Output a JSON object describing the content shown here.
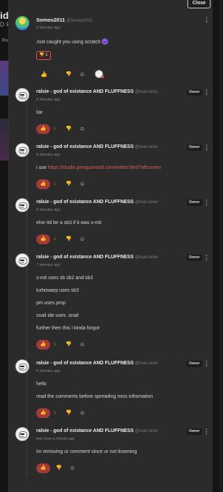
{
  "backdrop": {
    "title_fragment": "ide",
    "sub_fragment": "D F",
    "left_label": "Fo"
  },
  "close_label": "Close",
  "icons": {
    "like": "thumbs-up-icon",
    "dislike": "thumbs-down-icon",
    "react": "add-reaction-icon",
    "menu": "more-vertical-icon"
  },
  "colors": {
    "accent": "#e05a4f",
    "like_active": "#a63a3a",
    "link": "#e15c5c"
  },
  "comments": [
    {
      "author": "Somos2011",
      "handle": "@Somos2011",
      "time": "9 minutes ago",
      "lines": [
        "Just caught you using scratch"
      ],
      "reaction": {
        "emoji": "👎",
        "count": "1"
      },
      "likes": ""
    },
    {
      "author": "ralsie - god of existance AND FLUFFNESS",
      "handle": "@real-ralsie",
      "badge": "Owner",
      "time": "9 minutes ago",
      "lines": [
        "liar"
      ],
      "likes": "1"
    },
    {
      "author": "ralsie - god of existance AND FLUFFNESS",
      "handle": "@real-ralsie",
      "badge": "Owner",
      "time": "8 minutes ago",
      "lines_prefix": "i use ",
      "link": "https://studio.penguinmod.com/editor.html?offscreen",
      "likes": "1"
    },
    {
      "author": "ralsie - god of existance AND FLUFFNESS",
      "handle": "@real-ralsie",
      "badge": "Owner",
      "time": "8 minutes ago",
      "lines": [
        "else itd be a sb3 if it was s-mit"
      ],
      "likes": "1"
    },
    {
      "author": "ralsie - god of existance AND FLUFFNESS",
      "handle": "@real-ralsie",
      "badge": "Owner",
      "time": "7 minutes ago",
      "lines": [
        "s-mit uses sb sb2 and sb3",
        "turbowarp uses sb3",
        "pm uses pmp",
        "snail ide uses .snail",
        "further then this i kinda forgot"
      ],
      "likes": "1"
    },
    {
      "author": "ralsie - god of existance AND FLUFFNESS",
      "handle": "@real-ralsie",
      "badge": "Owner",
      "time": "6 minutes ago",
      "lines": [
        "hello",
        "read the comments before spreading miss infromation"
      ],
      "likes": "1"
    },
    {
      "author": "ralsie - god of existance AND FLUFFNESS",
      "handle": "@real-ralsie",
      "badge": "Owner",
      "time": "less than a minute ago",
      "lines": [
        "im removing ur comment since ur not lissening"
      ],
      "likes": ""
    }
  ]
}
